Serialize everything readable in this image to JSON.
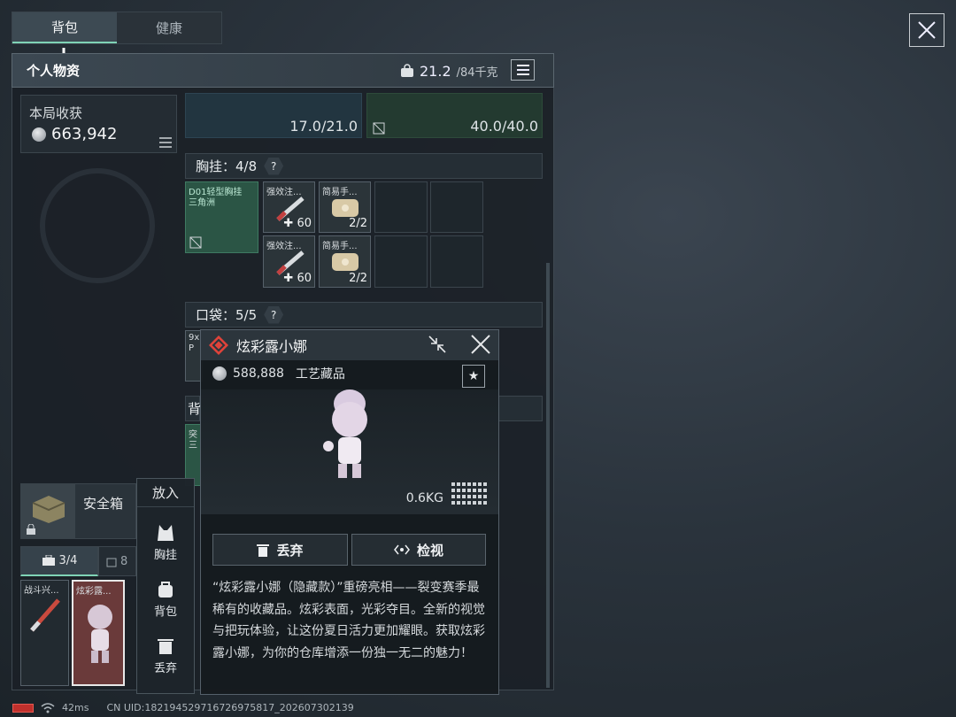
{
  "tabs": [
    {
      "label": "背包"
    },
    {
      "label": "健康"
    }
  ],
  "panel": {
    "title": "个人物资",
    "weight_current": "21.2",
    "weight_max": "/84千克",
    "weight_icon": "weight-icon"
  },
  "harvest": {
    "title": "本局收获",
    "value": "663,942"
  },
  "top_slots": [
    {
      "value": "17.0/21.0"
    },
    {
      "value": "40.0/40.0"
    }
  ],
  "chest_rig": {
    "label": "胸挂：4/8",
    "rig_item": {
      "name_line1": "D01轻型胸挂",
      "name_line2": "三角洲"
    },
    "items": [
      {
        "name": "强效注...",
        "qty": "60"
      },
      {
        "name": "简易手...",
        "qty": "2/2"
      },
      {
        "name": "强效注...",
        "qty": "60"
      },
      {
        "name": "简易手...",
        "qty": "2/2"
      }
    ]
  },
  "pockets": {
    "label": "口袋：5/5",
    "first_item": "9x",
    "first_item2": "P"
  },
  "backpack_row": {
    "label": "背",
    "item_line1": "突",
    "item_line2": "三"
  },
  "safebox": {
    "label": "安全箱"
  },
  "inner_tabs": [
    {
      "label": "3/4"
    },
    {
      "label": "8"
    }
  ],
  "safe_items": [
    {
      "name": "战斗兴..."
    },
    {
      "name": "炫彩露..."
    }
  ],
  "context_menu": {
    "title": "放入",
    "items": [
      {
        "label": "胸挂",
        "icon": "vest-icon"
      },
      {
        "label": "背包",
        "icon": "backpack-icon"
      },
      {
        "label": "丢弃",
        "icon": "trash-icon"
      }
    ]
  },
  "popup": {
    "title": "炫彩露小娜",
    "price": "588,888",
    "category": "工艺藏品",
    "weight": "0.6KG",
    "discard_label": "丢弃",
    "inspect_label": "检视",
    "description": "“炫彩露小娜（隐藏款）”重磅亮相——裂变赛季最稀有的收藏品。炫彩表面，光彩夺目。全新的视觉与把玩体验，让这份夏日活力更加耀眼。获取炫彩露小娜，为你的仓库增添一份独一无二的魅力！"
  },
  "status": {
    "ping": "42ms",
    "uid": "CN UID:182194529716726975817_202607302139"
  },
  "colors": {
    "accent": "#7fd3b6",
    "rarity": "#e0433a",
    "highlight_item": "#6a3a3a"
  }
}
